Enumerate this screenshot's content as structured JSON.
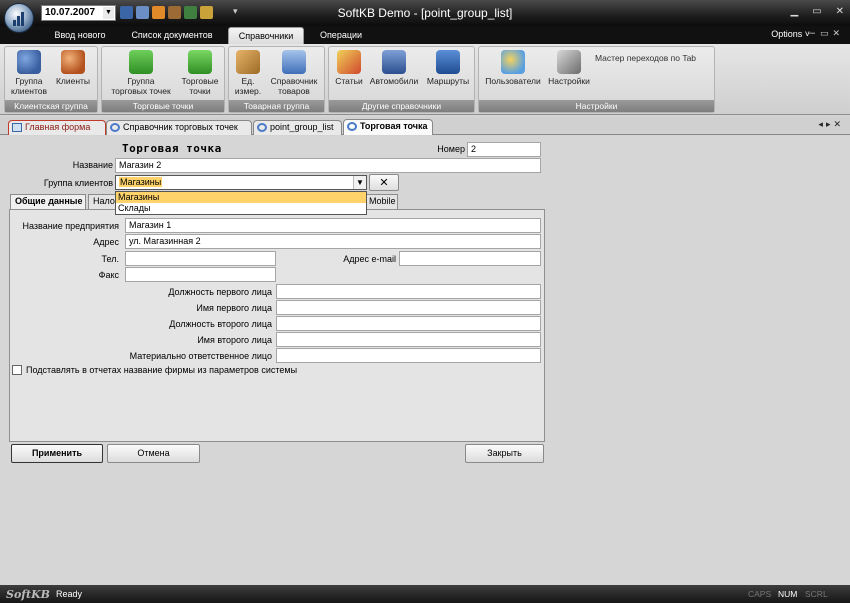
{
  "window": {
    "title": "SoftKB Demo - [point_group_list]",
    "date": "10.07.2007",
    "options_label": "Options ˅",
    "more_glyph": "≡"
  },
  "ribbon_tabs": [
    "Ввод нового",
    "Список документов",
    "Справочники",
    "Операции"
  ],
  "ribbon": {
    "groups": [
      {
        "caption": "Клиентская группа",
        "buttons": [
          {
            "label": "Группа\nклиентов",
            "icon": "users-group-icon"
          },
          {
            "label": "Клиенты",
            "icon": "clients-icon"
          }
        ]
      },
      {
        "caption": "Торговые точки",
        "buttons": [
          {
            "label": "Группа\nторговых точек",
            "icon": "store-group-icon"
          },
          {
            "label": "Торговые\nточки",
            "icon": "store-icon"
          }
        ]
      },
      {
        "caption": "Товарная группа",
        "buttons": [
          {
            "label": "Ед.\nизмер.",
            "icon": "ruler-icon"
          },
          {
            "label": "Справочник\nтоваров",
            "icon": "catalog-icon"
          }
        ]
      },
      {
        "caption": "Другие справочники",
        "buttons": [
          {
            "label": "Статьи",
            "icon": "articles-icon"
          },
          {
            "label": "Автомобили",
            "icon": "truck-icon"
          },
          {
            "label": "Маршруты",
            "icon": "route-icon"
          }
        ]
      },
      {
        "caption": "Настройки",
        "buttons": [
          {
            "label": "Пользователи",
            "icon": "users-icon"
          },
          {
            "label": "Настройки",
            "icon": "wrench-icon"
          }
        ],
        "link": "Мастер переходов по Tab"
      }
    ]
  },
  "doc_tabs": [
    {
      "label": "Главная форма"
    },
    {
      "label": "Справочник торговых точек"
    },
    {
      "label": "point_group_list"
    },
    {
      "label": "Торговая точка"
    }
  ],
  "form": {
    "title": "Торговая точка",
    "number_label": "Номер",
    "number_value": "2",
    "name_label": "Название",
    "name_value": "Магазин 2",
    "client_group_label": "Группа клиентов",
    "client_group_value": "Магазины",
    "clear_glyph": "✕",
    "dropdown_options": [
      "Магазины",
      "Склады"
    ],
    "tabs": [
      "Общие данные",
      "Нало",
      "Mobile"
    ],
    "fields": {
      "company_label": "Название предприятия",
      "company_value": "Магазин 1",
      "address_label": "Адрес",
      "address_value": "ул. Магазинная 2",
      "phone_label": "Тел.",
      "email_label": "Адрес e-mail",
      "fax_label": "Факс",
      "pos1_label": "Должность первого лица",
      "name1_label": "Имя первого лица",
      "pos2_label": "Должность второго лица",
      "name2_label": "Имя второго лица",
      "responsible_label": "Материально ответственное лицо"
    },
    "checkbox_label": "Подставлять в отчетах название фирмы из параметров системы",
    "apply": "Применить",
    "cancel": "Отмена",
    "close": "Закрыть"
  },
  "status": {
    "logo": "SoftKB",
    "ready": "Ready",
    "caps": "CAPS",
    "num": "NUM",
    "scrl": "SCRL"
  }
}
